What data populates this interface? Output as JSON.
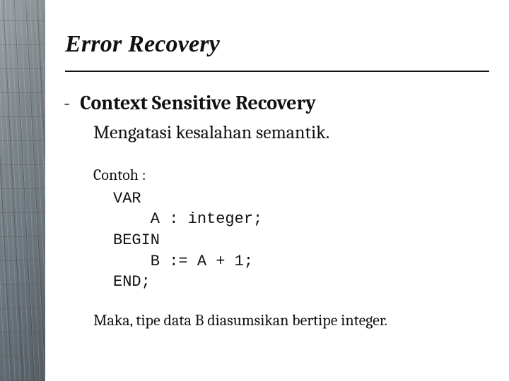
{
  "title": "Error Recovery",
  "bullet": {
    "dash": "-",
    "heading": "Context Sensitive Recovery",
    "description": "Mengatasi kesalahan semantik."
  },
  "example": {
    "label": "Contoh :",
    "code": "VAR\n    A : integer;\nBEGIN\n    B := A + 1;\nEND;"
  },
  "conclusion": "Maka, tipe data B diasumsikan bertipe integer."
}
